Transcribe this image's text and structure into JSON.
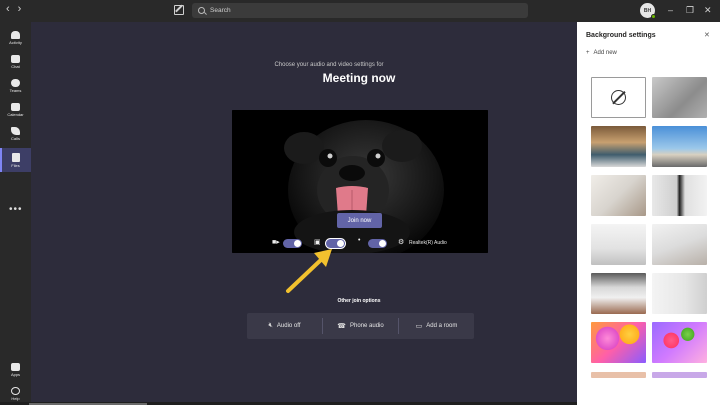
{
  "search": {
    "placeholder": "Search"
  },
  "user": {
    "initials": "BH"
  },
  "rail": [
    {
      "name": "activity",
      "label": "Activity"
    },
    {
      "name": "chat",
      "label": "Chat"
    },
    {
      "name": "teams",
      "label": "Teams"
    },
    {
      "name": "calendar",
      "label": "Calendar"
    },
    {
      "name": "calls",
      "label": "Calls"
    },
    {
      "name": "files",
      "label": "Files"
    }
  ],
  "rail_bottom": [
    {
      "name": "apps",
      "label": "Apps"
    },
    {
      "name": "help",
      "label": "Help"
    }
  ],
  "prejoin": {
    "subtitle": "Choose your audio and video settings for",
    "title": "Meeting now",
    "join_label": "Join now",
    "device_label": "Realtek(R) Audio",
    "other_title": "Other join options",
    "options": [
      {
        "name": "audio-off",
        "label": "Audio off",
        "icon": "speaker-off-icon"
      },
      {
        "name": "phone-audio",
        "label": "Phone audio",
        "icon": "phone-icon"
      },
      {
        "name": "add-room",
        "label": "Add a room",
        "icon": "cast-icon"
      }
    ],
    "toggles": {
      "camera": true,
      "background_blur": true,
      "microphone": true
    }
  },
  "panel": {
    "title": "Background settings",
    "add_new": "Add new"
  },
  "colors": {
    "accent": "#6264a7",
    "arrow": "#f2c12e",
    "main_bg": "#2d2c3b"
  }
}
